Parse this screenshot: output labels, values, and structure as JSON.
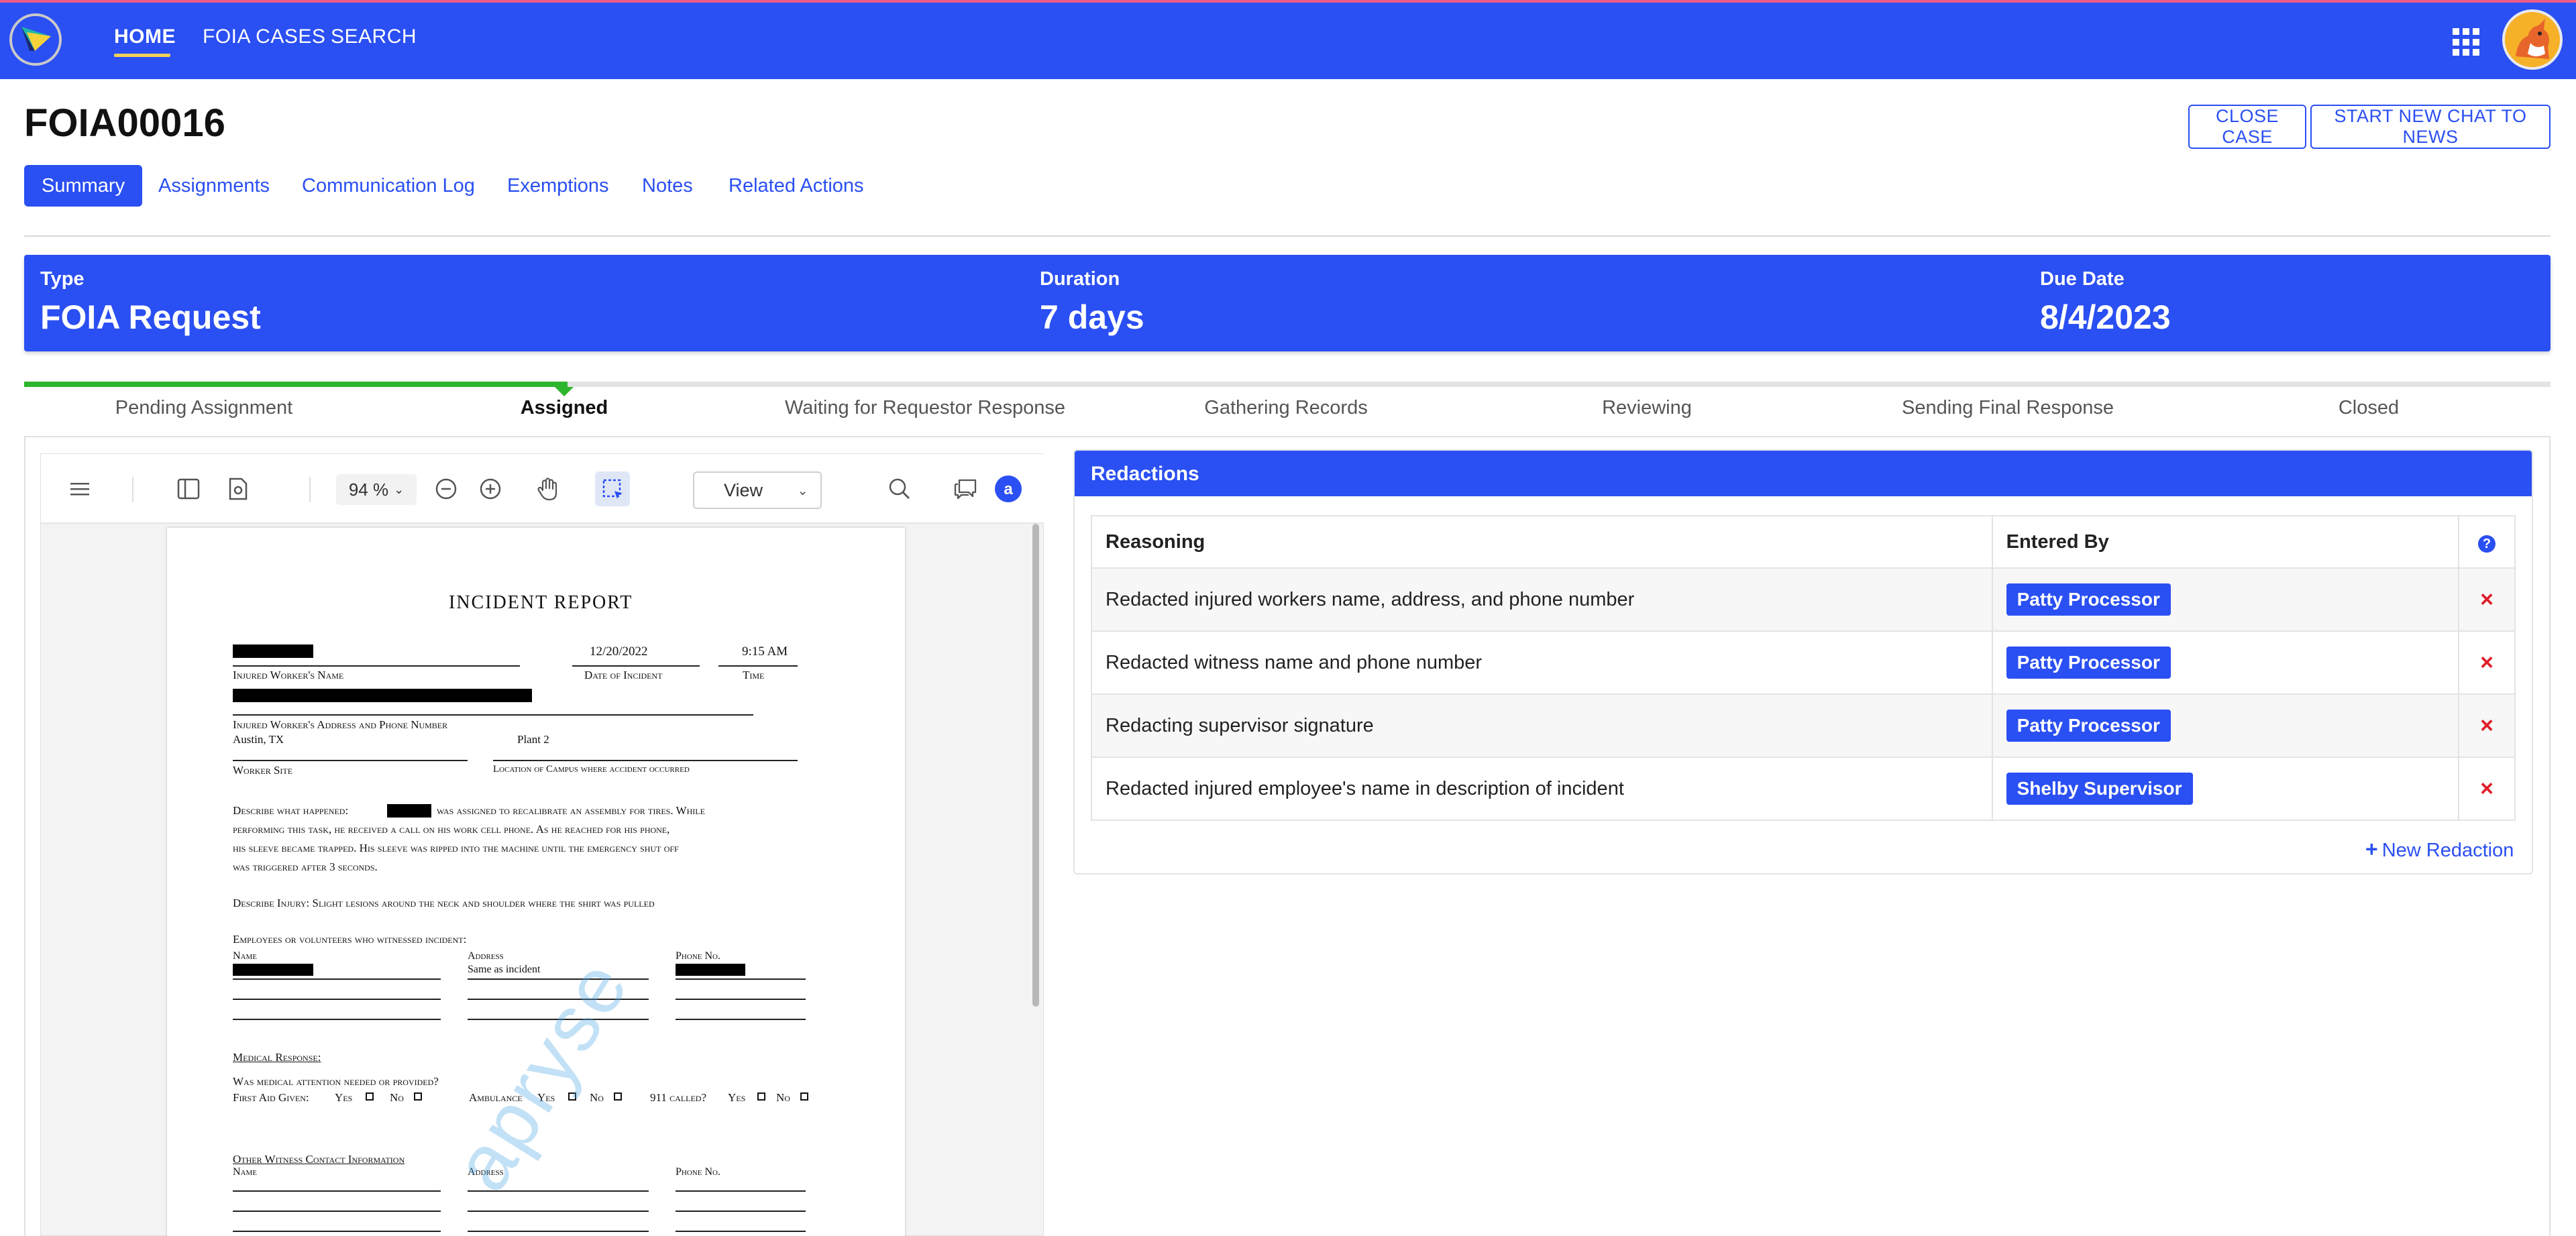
{
  "nav": {
    "items": [
      {
        "label": "HOME",
        "active": true
      },
      {
        "label": "FOIA CASES",
        "active": false
      },
      {
        "label": "SEARCH",
        "active": false
      }
    ],
    "apps_icon": "apps-grid-icon",
    "avatar_icon": "user-avatar"
  },
  "case": {
    "id": "FOIA00016",
    "actions": {
      "close": "CLOSE CASE",
      "chat": "START NEW CHAT TO NEWS"
    }
  },
  "tabs": [
    {
      "label": "Summary",
      "active": true
    },
    {
      "label": "Assignments",
      "active": false
    },
    {
      "label": "Communication Log",
      "active": false
    },
    {
      "label": "Exemptions",
      "active": false
    },
    {
      "label": "Notes",
      "active": false
    },
    {
      "label": "Related Actions",
      "active": false
    }
  ],
  "summary": {
    "type_label": "Type",
    "type_value": "FOIA Request",
    "duration_label": "Duration",
    "duration_value": "7 days",
    "due_label": "Due Date",
    "due_value": "8/4/2023"
  },
  "workflow": {
    "stages": [
      "Pending Assignment",
      "Assigned",
      "Waiting for Requestor Response",
      "Gathering Records",
      "Reviewing",
      "Sending Final Response",
      "Closed"
    ],
    "current_index": 1
  },
  "viewer": {
    "zoom": "94 %",
    "view_mode": "View",
    "icons": [
      "menu-icon",
      "sidebar-panel-icon",
      "page-settings-icon",
      "zoom-out-icon",
      "zoom-in-icon",
      "pan-hand-icon",
      "select-region-icon",
      "search-icon",
      "comments-icon",
      "apryse-icon"
    ]
  },
  "document": {
    "title": "INCIDENT REPORT",
    "date": "12/20/2022",
    "time": "9:15 AM",
    "label_name": "Injured Worker's Name",
    "label_date": "Date of Incident",
    "label_time": "Time",
    "label_address": "Injured Worker's Address and Phone Number",
    "city": "Austin, TX",
    "site_value": "Plant 2",
    "label_site": "Worker Site",
    "label_location": "Location of Campus where accident occurred",
    "what_prefix": "Describe what happened:",
    "what_line1": "was assigned to recalibrate an assembly for tires. While",
    "what_line2": "performing this task, he received a call on his work cell phone. As he reached for his phone,",
    "what_line3": "his sleeve became trapped. His sleeve was ripped into the machine until the emergency shut off",
    "what_line4": "was triggered after 3 seconds.",
    "injury": "Describe Injury: Slight lesions around the neck and shoulder where the shirt was pulled",
    "witness_heading": "Employees or volunteers who witnessed incident:",
    "col_name": "Name",
    "col_address": "Address",
    "col_phone": "Phone No.",
    "witness_address": "Same as incident",
    "medical_heading": "Medical Response:",
    "medical_q": "Was medical attention needed or provided?",
    "first_aid": "First Aid Given:",
    "ambulance": "Ambulance",
    "called_911": "911 called?",
    "yes": "Yes",
    "no": "No",
    "other_heading": "Other Witness Contact Information",
    "watermark": "apryse"
  },
  "redactions": {
    "title": "Redactions",
    "col_reasoning": "Reasoning",
    "col_entered_by": "Entered By",
    "help_icon": "help-icon",
    "rows": [
      {
        "reasoning": "Redacted injured workers name, address, and phone number",
        "entered_by": "Patty Processor"
      },
      {
        "reasoning": "Redacted witness name and phone number",
        "entered_by": "Patty Processor"
      },
      {
        "reasoning": "Redacting supervisor signature",
        "entered_by": "Patty Processor"
      },
      {
        "reasoning": "Redacted injured employee's name in description of incident",
        "entered_by": "Shelby Supervisor"
      }
    ],
    "delete_symbol": "×",
    "new_label": "New Redaction"
  },
  "colors": {
    "brand": "#2a4ff2",
    "progress": "#2db52d",
    "delete": "#e01e2b"
  }
}
